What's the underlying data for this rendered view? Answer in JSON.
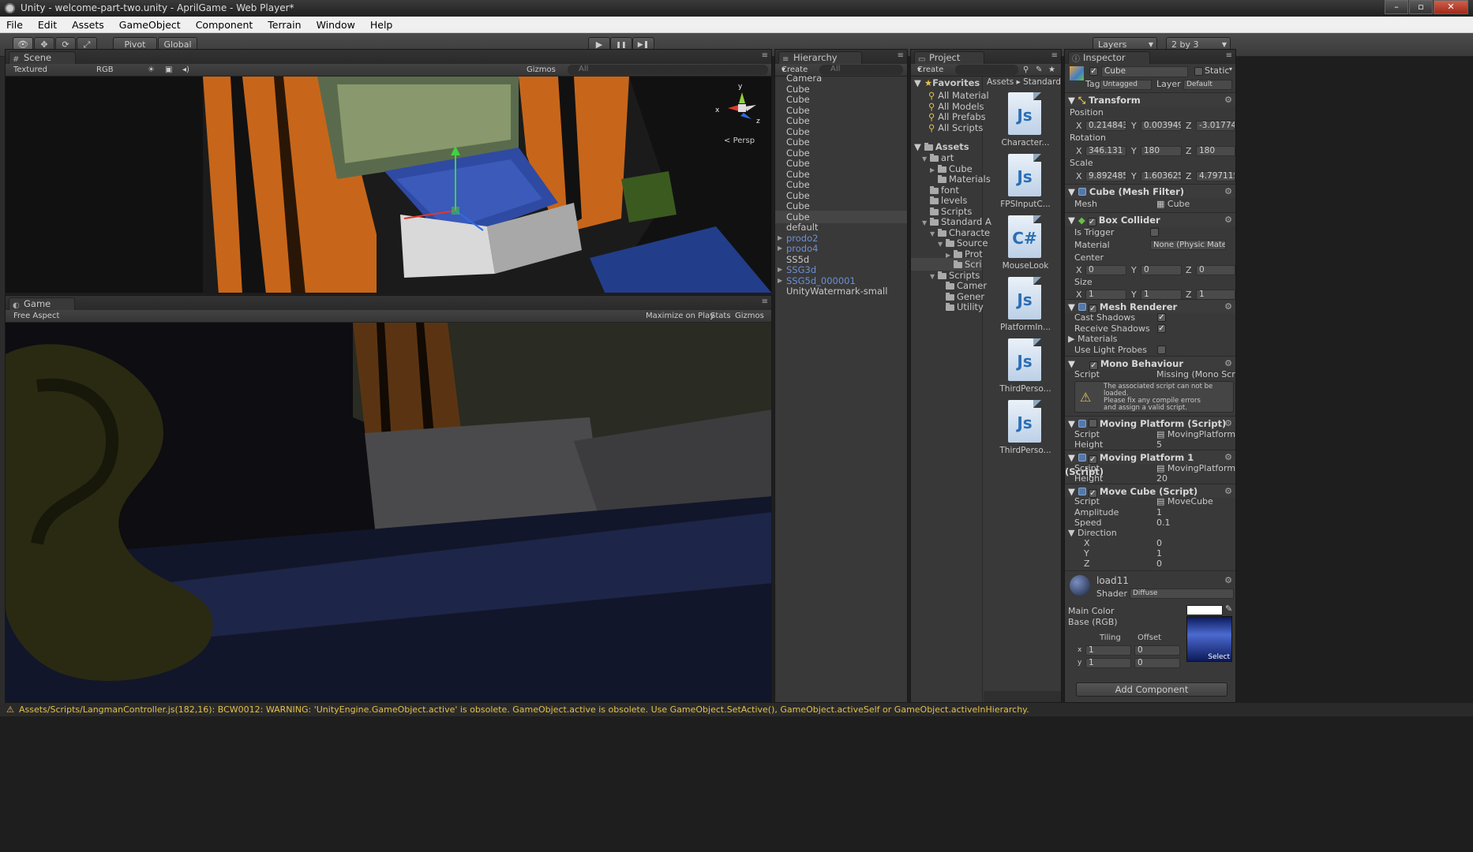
{
  "window": {
    "title": "Unity - welcome-part-two.unity - AprilGame - Web Player*",
    "buttons": [
      "–",
      "▫",
      "✕"
    ]
  },
  "menu": [
    "File",
    "Edit",
    "Assets",
    "GameObject",
    "Component",
    "Terrain",
    "Window",
    "Help"
  ],
  "toolbar": {
    "pivot": "Pivot",
    "global": "Global",
    "layers": "Layers",
    "layout": "2 by 3",
    "play": "▶",
    "pause": "❚❚",
    "step": "▶❚"
  },
  "scene": {
    "tab": "Scene",
    "render_mode": "Textured",
    "color_mode": "RGB",
    "gizmos": "Gizmos",
    "search": "All",
    "persp": "Persp",
    "axis_x": "x",
    "axis_y": "y",
    "axis_z": "z"
  },
  "game": {
    "tab": "Game",
    "aspect": "Free Aspect",
    "maximize": "Maximize on Play",
    "stats": "Stats",
    "gizmos": "Gizmos"
  },
  "hierarchy": {
    "tab": "Hierarchy",
    "create": "Create",
    "search": "All",
    "items": [
      {
        "label": "Camera",
        "expandable": false,
        "prefab": false
      },
      {
        "label": "Cube",
        "expandable": false,
        "prefab": false
      },
      {
        "label": "Cube",
        "expandable": false,
        "prefab": false
      },
      {
        "label": "Cube",
        "expandable": false,
        "prefab": false
      },
      {
        "label": "Cube",
        "expandable": false,
        "prefab": false
      },
      {
        "label": "Cube",
        "expandable": false,
        "prefab": false
      },
      {
        "label": "Cube",
        "expandable": false,
        "prefab": false
      },
      {
        "label": "Cube",
        "expandable": false,
        "prefab": false
      },
      {
        "label": "Cube",
        "expandable": false,
        "prefab": false
      },
      {
        "label": "Cube",
        "expandable": false,
        "prefab": false
      },
      {
        "label": "Cube",
        "expandable": false,
        "prefab": false
      },
      {
        "label": "Cube",
        "expandable": false,
        "prefab": false
      },
      {
        "label": "Cube",
        "expandable": false,
        "prefab": false
      },
      {
        "label": "Cube",
        "expandable": false,
        "prefab": false,
        "selected": true
      },
      {
        "label": "default",
        "expandable": false,
        "prefab": false
      },
      {
        "label": "prodo2",
        "expandable": true,
        "prefab": true
      },
      {
        "label": "prodo4",
        "expandable": true,
        "prefab": true
      },
      {
        "label": "SS5d",
        "expandable": false,
        "prefab": false
      },
      {
        "label": "SSG3d",
        "expandable": true,
        "prefab": true
      },
      {
        "label": "SSG5d_000001",
        "expandable": true,
        "prefab": true
      },
      {
        "label": "UnityWatermark-small",
        "expandable": false,
        "prefab": false
      }
    ]
  },
  "project": {
    "tab": "Project",
    "create": "Create",
    "breadcrumb": [
      "Assets",
      "Standard"
    ],
    "favorites_label": "Favorites",
    "favorites": [
      "All Material",
      "All Models",
      "All Prefabs",
      "All Scripts"
    ],
    "assets_label": "Assets",
    "tree": [
      {
        "label": "art",
        "depth": 1,
        "arrow": "▼"
      },
      {
        "label": "Cube",
        "depth": 2,
        "arrow": "▶"
      },
      {
        "label": "Materials",
        "depth": 2,
        "arrow": ""
      },
      {
        "label": "font",
        "depth": 1,
        "arrow": ""
      },
      {
        "label": "levels",
        "depth": 1,
        "arrow": ""
      },
      {
        "label": "Scripts",
        "depth": 1,
        "arrow": ""
      },
      {
        "label": "Standard A",
        "depth": 1,
        "arrow": "▼"
      },
      {
        "label": "Characte",
        "depth": 2,
        "arrow": "▼"
      },
      {
        "label": "Source",
        "depth": 3,
        "arrow": "▼"
      },
      {
        "label": "Prot",
        "depth": 4,
        "arrow": "▶"
      },
      {
        "label": "Scri",
        "depth": 4,
        "arrow": "",
        "selected": true
      },
      {
        "label": "Scripts",
        "depth": 2,
        "arrow": "▼"
      },
      {
        "label": "Camer",
        "depth": 3,
        "arrow": ""
      },
      {
        "label": "Gener",
        "depth": 3,
        "arrow": ""
      },
      {
        "label": "Utility",
        "depth": 3,
        "arrow": ""
      }
    ],
    "files": [
      {
        "label": "Character...",
        "kind": "Js"
      },
      {
        "label": "FPSInputC...",
        "kind": "Js"
      },
      {
        "label": "MouseLook",
        "kind": "C#"
      },
      {
        "label": "PlatformIn...",
        "kind": "Js"
      },
      {
        "label": "ThirdPerso...",
        "kind": "Js"
      },
      {
        "label": "ThirdPerso...",
        "kind": "Js"
      }
    ]
  },
  "inspector": {
    "tab": "Inspector",
    "name": "Cube",
    "static": "Static",
    "tag_label": "Tag",
    "tag": "Untagged",
    "layer_label": "Layer",
    "layer": "Default",
    "transform": {
      "title": "Transform",
      "position_label": "Position",
      "rotation_label": "Rotation",
      "scale_label": "Scale",
      "position": [
        "0.214843",
        "0.003949",
        "-3.017749"
      ],
      "rotation": [
        "346.131",
        "180",
        "180"
      ],
      "scale": [
        "9.892485",
        "1.603625",
        "4.797115"
      ]
    },
    "mesh_filter": {
      "title": "Cube (Mesh Filter)",
      "mesh_label": "Mesh",
      "mesh": "Cube"
    },
    "box_collider": {
      "title": "Box Collider",
      "is_trigger": "Is Trigger",
      "material_label": "Material",
      "material": "None (Physic Mate",
      "center_label": "Center",
      "center": [
        "0",
        "0",
        "0"
      ],
      "size_label": "Size",
      "size": [
        "1",
        "1",
        "1"
      ]
    },
    "mesh_renderer": {
      "title": "Mesh Renderer",
      "cast": "Cast Shadows",
      "receive": "Receive Shadows",
      "materials": "Materials",
      "light_probes": "Use Light Probes"
    },
    "mono": {
      "title": "Mono Behaviour",
      "script_label": "Script",
      "script": "Missing (Mono Scr",
      "warning": [
        "The associated script can not be",
        "loaded.",
        "Please fix any compile errors",
        "and assign a valid script."
      ]
    },
    "moving_platform": {
      "title": "Moving Platform (Script)",
      "script_label": "Script",
      "script": "MovingPlatform",
      "height_label": "Height",
      "height": "5"
    },
    "moving_platform1": {
      "title": "Moving Platform 1 (Script)",
      "script_label": "Script",
      "script": "MovingPlatform:",
      "height_label": "Height",
      "height": "20"
    },
    "move_cube": {
      "title": "Move Cube (Script)",
      "script_label": "Script",
      "script": "MoveCube",
      "amplitude_label": "Amplitude",
      "amplitude": "1",
      "speed_label": "Speed",
      "speed": "0.1",
      "direction_label": "Direction",
      "dir_x_label": "X",
      "dir_x": "0",
      "dir_y_label": "Y",
      "dir_y": "1",
      "dir_z_label": "Z",
      "dir_z": "0"
    },
    "material": {
      "name": "load11",
      "shader_label": "Shader",
      "shader": "Diffuse",
      "main_color": "Main Color",
      "base": "Base (RGB)",
      "tiling": "Tiling",
      "offset": "Offset",
      "tx": "1",
      "ty": "1",
      "ox": "0",
      "oy": "0",
      "select": "Select",
      "x_label": "x",
      "y_label": "y"
    },
    "add_component": "Add Component"
  },
  "status": "Assets/Scripts/LangmanController.js(182,16): BCW0012: WARNING: 'UnityEngine.GameObject.active' is obsolete. GameObject.active is obsolete. Use GameObject.SetActive(), GameObject.activeSelf or GameObject.activeInHierarchy.",
  "colors": {
    "accent": "#4a78c2",
    "warning": "#e3c04a",
    "prefab": "#6c8fd6"
  }
}
